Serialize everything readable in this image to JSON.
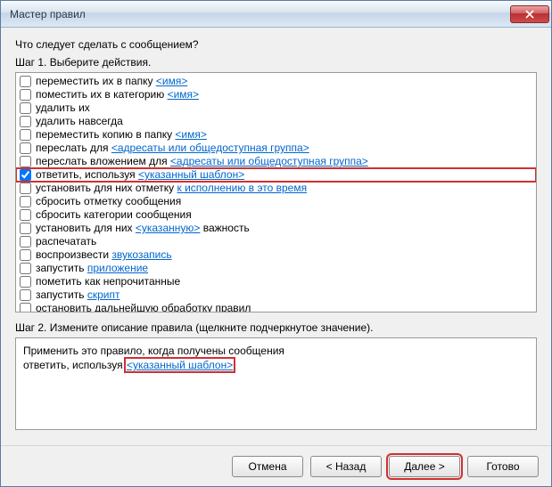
{
  "window": {
    "title": "Мастер правил"
  },
  "prompt": "Что следует сделать с сообщением?",
  "step1_label": "Шаг 1. Выберите действия.",
  "actions": [
    {
      "checked": false,
      "parts": [
        {
          "t": "переместить их в папку "
        },
        {
          "t": "<имя>",
          "link": true
        }
      ]
    },
    {
      "checked": false,
      "parts": [
        {
          "t": "поместить их в категорию "
        },
        {
          "t": "<имя>",
          "link": true
        }
      ]
    },
    {
      "checked": false,
      "parts": [
        {
          "t": "удалить их"
        }
      ]
    },
    {
      "checked": false,
      "parts": [
        {
          "t": "удалить навсегда"
        }
      ]
    },
    {
      "checked": false,
      "parts": [
        {
          "t": "переместить копию в папку "
        },
        {
          "t": "<имя>",
          "link": true
        }
      ]
    },
    {
      "checked": false,
      "parts": [
        {
          "t": "переслать для "
        },
        {
          "t": "<адресаты или общедоступная группа>",
          "link": true
        }
      ]
    },
    {
      "checked": false,
      "parts": [
        {
          "t": "переслать вложением для "
        },
        {
          "t": "<адресаты или общедоступная группа>",
          "link": true
        }
      ]
    },
    {
      "checked": true,
      "hl": true,
      "parts": [
        {
          "t": "ответить, используя "
        },
        {
          "t": "<указанный шаблон>",
          "link": true
        }
      ]
    },
    {
      "checked": false,
      "parts": [
        {
          "t": "установить для них отметку "
        },
        {
          "t": "к исполнению в это время",
          "link": true
        }
      ]
    },
    {
      "checked": false,
      "parts": [
        {
          "t": "сбросить отметку сообщения"
        }
      ]
    },
    {
      "checked": false,
      "parts": [
        {
          "t": "сбросить категории сообщения"
        }
      ]
    },
    {
      "checked": false,
      "parts": [
        {
          "t": "установить для них "
        },
        {
          "t": "<указанную>",
          "link": true
        },
        {
          "t": " важность"
        }
      ]
    },
    {
      "checked": false,
      "parts": [
        {
          "t": "распечатать"
        }
      ]
    },
    {
      "checked": false,
      "parts": [
        {
          "t": "воспроизвести "
        },
        {
          "t": "звукозапись",
          "link": true
        }
      ]
    },
    {
      "checked": false,
      "parts": [
        {
          "t": "запустить "
        },
        {
          "t": "приложение",
          "link": true
        }
      ]
    },
    {
      "checked": false,
      "parts": [
        {
          "t": "пометить как непрочитанные"
        }
      ]
    },
    {
      "checked": false,
      "parts": [
        {
          "t": "запустить "
        },
        {
          "t": "скрипт",
          "link": true
        }
      ]
    },
    {
      "checked": false,
      "parts": [
        {
          "t": "остановить дальнейшую обработку правил"
        }
      ]
    }
  ],
  "step2_label": "Шаг 2. Измените описание правила (щелкните подчеркнутое значение).",
  "description": {
    "line1": "Применить это правило, когда получены сообщения",
    "line2_prefix": "ответить, используя ",
    "line2_link": "<указанный шаблон>"
  },
  "buttons": {
    "cancel": "Отмена",
    "back": "< Назад",
    "next": "Далее >",
    "finish": "Готово"
  }
}
